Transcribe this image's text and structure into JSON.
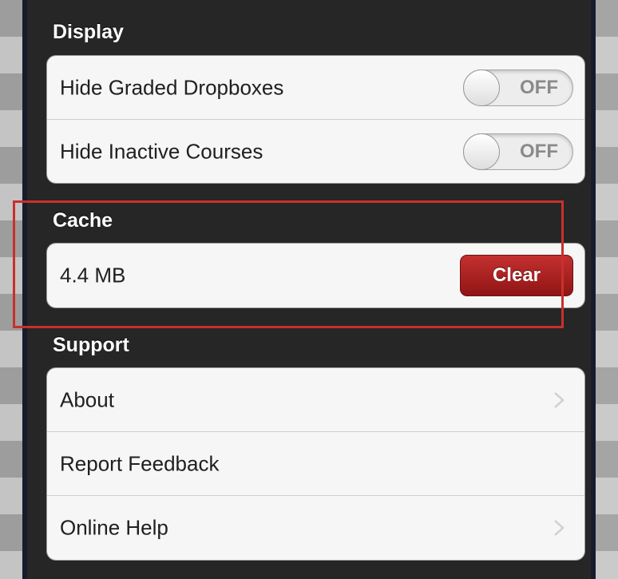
{
  "display": {
    "title": "Display",
    "items": [
      {
        "label": "Hide Graded Dropboxes",
        "toggle": "OFF"
      },
      {
        "label": "Hide Inactive Courses",
        "toggle": "OFF"
      }
    ]
  },
  "cache": {
    "title": "Cache",
    "size": "4.4 MB",
    "clear_label": "Clear"
  },
  "support": {
    "title": "Support",
    "items": [
      {
        "label": "About"
      },
      {
        "label": "Report Feedback"
      },
      {
        "label": "Online Help"
      }
    ]
  },
  "colors": {
    "accent_red": "#c9302c",
    "button_red": "#b02222",
    "panel_bg": "#262626"
  }
}
